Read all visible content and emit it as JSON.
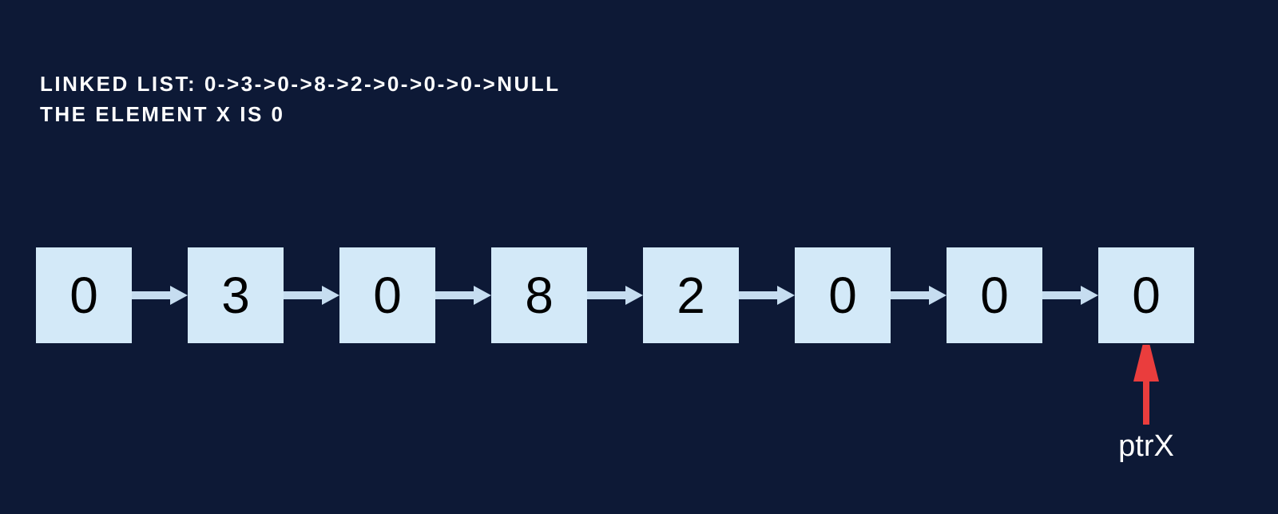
{
  "heading": {
    "line1": "LINKED LIST: 0->3->0->8->2->0->0->0->NULL",
    "line2": "THE ELEMENT X IS 0"
  },
  "nodes": [
    {
      "value": "0"
    },
    {
      "value": "3"
    },
    {
      "value": "0"
    },
    {
      "value": "8"
    },
    {
      "value": "2"
    },
    {
      "value": "0"
    },
    {
      "value": "0"
    },
    {
      "value": "0"
    }
  ],
  "pointer": {
    "label": "ptrX",
    "targetIndex": 7
  },
  "colors": {
    "background": "#0d1936",
    "nodeFill": "#d3e9f8",
    "linkArrow": "#c6ddf0",
    "pointerArrow": "#ea3d3d",
    "text": "#ffffff"
  }
}
